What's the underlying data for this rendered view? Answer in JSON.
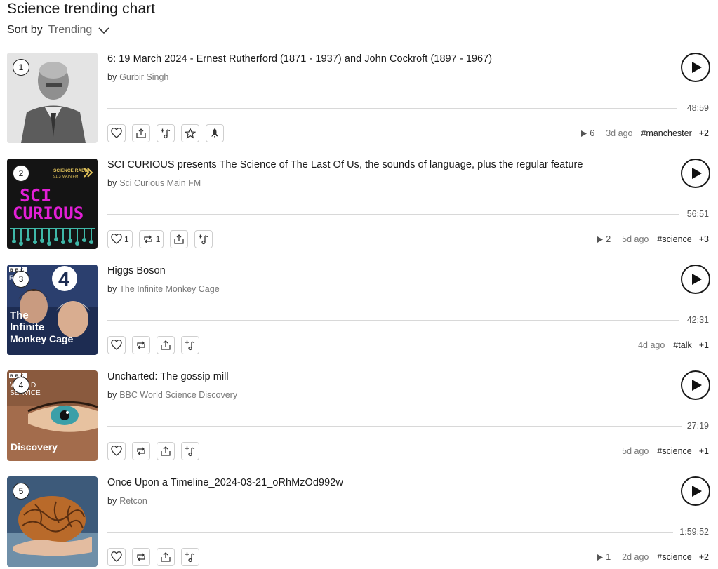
{
  "page": {
    "title": "Science trending chart",
    "sort_label": "Sort by",
    "sort_value": "Trending"
  },
  "tracks": [
    {
      "rank": "1",
      "title": "6: 19 March 2024 - Ernest Rutherford (1871 - 1937) and John Cockroft (1897 - 1967)",
      "by": "by",
      "author": "Gurbir Singh",
      "duration": "48:59",
      "likes": "",
      "reposts": "",
      "plays": "6",
      "time_ago": "3d ago",
      "tag": "#manchester",
      "more_tags": "+2"
    },
    {
      "rank": "2",
      "title": "SCI CURIOUS presents The Science of The Last Of Us, the sounds of language, plus the regular feature",
      "by": "by",
      "author": "Sci Curious Main FM",
      "duration": "56:51",
      "likes": "1",
      "reposts": "1",
      "plays": "2",
      "time_ago": "5d ago",
      "tag": "#science",
      "more_tags": "+3",
      "art_text": {
        "radio": "SCIENCE RADIO",
        "freq": "91.3 MAIN FM",
        "l1": "SCI",
        "l2": "CURIOUS"
      }
    },
    {
      "rank": "3",
      "title": "Higgs Boson",
      "by": "by",
      "author": "The Infinite Monkey Cage",
      "duration": "42:31",
      "time_ago": "4d ago",
      "tag": "#talk",
      "more_tags": "+1",
      "art_text": {
        "bbc": "BBC",
        "radio": "RADIO",
        "num": "4",
        "l1": "The",
        "l2": "Infinite",
        "l3": "Monkey Cage"
      }
    },
    {
      "rank": "4",
      "title": "Uncharted: The gossip mill",
      "by": "by",
      "author": "BBC World Science Discovery",
      "duration": "27:19",
      "time_ago": "5d ago",
      "tag": "#science",
      "more_tags": "+1",
      "art_text": {
        "bbc": "BBC",
        "world": "WORLD",
        "service": "SERVICE",
        "label": "Discovery"
      }
    },
    {
      "rank": "5",
      "title": "Once Upon a Timeline_2024-03-21_oRhMzOd992w",
      "by": "by",
      "author": "Retcon",
      "duration": "1:59:52",
      "plays": "1",
      "time_ago": "2d ago",
      "tag": "#science",
      "more_tags": "+2"
    }
  ],
  "colors": {
    "text": "#1a1a1a",
    "muted": "#777777",
    "border": "#cfcfcf",
    "progress": "#d8d8d8",
    "scicurious_magenta": "#e21fd6",
    "scicurious_teal": "#3fb8a8"
  },
  "icons": {
    "like": "heart-icon",
    "repost": "repost-icon",
    "share": "share-icon",
    "add_to_playlist": "add-to-playlist-icon",
    "favorite": "star-icon",
    "boost": "rocket-icon",
    "play": "play-icon",
    "plays": "play-count-icon",
    "sort": "chevron-down-icon"
  }
}
